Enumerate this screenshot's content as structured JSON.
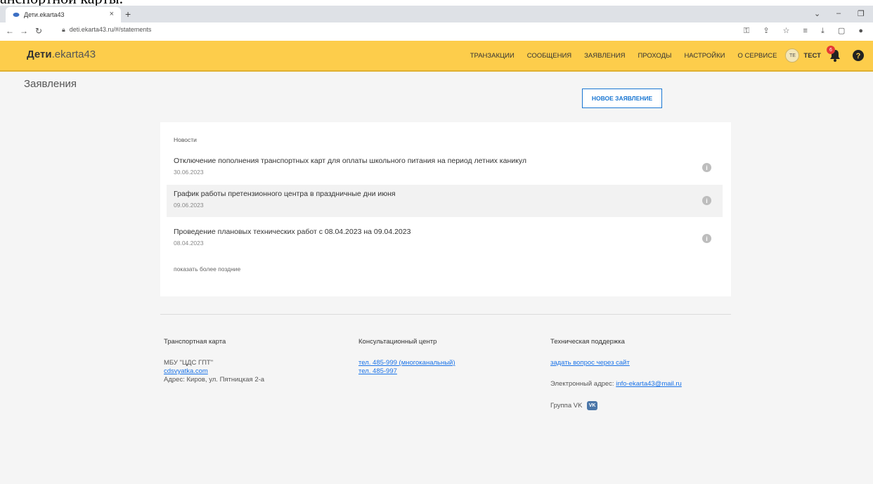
{
  "doc_crop_text": "анспортной карты.",
  "browser": {
    "tab_title": "Дети.ekarta43",
    "tab_close": "×",
    "new_tab": "+",
    "url": "deti.ekarta43.ru/#/statements"
  },
  "header": {
    "brand_bold": "Дети",
    "brand_rest": ".ekarta43",
    "nav": [
      "ТРАНЗАКЦИИ",
      "СООБЩЕНИЯ",
      "ЗАЯВЛЕНИЯ",
      "ПРОХОДЫ",
      "НАСТРОЙКИ",
      "О СЕРВИСЕ"
    ],
    "user_initials": "TE",
    "user_name": "ТЕСТ",
    "notifications_count": "6"
  },
  "page": {
    "title": "Заявления",
    "new_statement_button": "НОВОЕ ЗАЯВЛЕНИЕ"
  },
  "news": {
    "heading": "Новости",
    "items": [
      {
        "title": "Отключение пополнения транспортных карт для оплаты школьного питания на период летних каникул",
        "date": "30.06.2023"
      },
      {
        "title": "График работы претензионного центра в праздничные дни июня",
        "date": "09.06.2023"
      },
      {
        "title": "Проведение плановых технических работ с 08.04.2023 на 09.04.2023",
        "date": "08.04.2023"
      }
    ],
    "more": "показать более поздние"
  },
  "footer": {
    "transport": {
      "heading": "Транспортная карта",
      "org": "МБУ \"ЦДС ГПТ\"",
      "site": "cdsvyatka.com",
      "address": "Адрес: Киров, ул. Пятницкая 2-а"
    },
    "consult": {
      "heading": "Консультационный центр",
      "phone1": "тел. 485-999 (многоканальный)",
      "phone2": "тел. 485-997"
    },
    "support": {
      "heading": "Техническая поддержка",
      "ask": "задать вопрос через сайт",
      "email_label": "Электронный адрес: ",
      "email": "info-ekarta43@mail.ru",
      "vk_label": "Группа VK",
      "vk_icon_text": "VK"
    }
  }
}
